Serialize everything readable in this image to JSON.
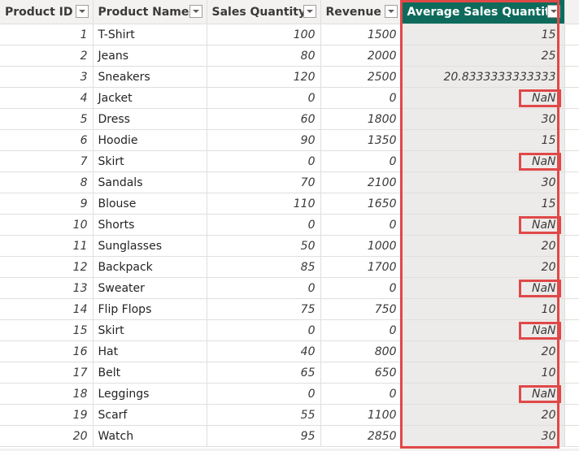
{
  "table": {
    "columns": [
      {
        "label": "Product ID"
      },
      {
        "label": "Product Name"
      },
      {
        "label": "Sales Quantity"
      },
      {
        "label": "Revenue"
      },
      {
        "label": "Average Sales Quantity",
        "selected": true
      }
    ],
    "rows": [
      {
        "id": "1",
        "name": "T-Shirt",
        "qty": "100",
        "revenue": "1500",
        "avg": "15"
      },
      {
        "id": "2",
        "name": "Jeans",
        "qty": "80",
        "revenue": "2000",
        "avg": "25"
      },
      {
        "id": "3",
        "name": "Sneakers",
        "qty": "120",
        "revenue": "2500",
        "avg": "20.8333333333333"
      },
      {
        "id": "4",
        "name": "Jacket",
        "qty": "0",
        "revenue": "0",
        "avg": "NaN",
        "highlight": true
      },
      {
        "id": "5",
        "name": "Dress",
        "qty": "60",
        "revenue": "1800",
        "avg": "30"
      },
      {
        "id": "6",
        "name": "Hoodie",
        "qty": "90",
        "revenue": "1350",
        "avg": "15"
      },
      {
        "id": "7",
        "name": "Skirt",
        "qty": "0",
        "revenue": "0",
        "avg": "NaN",
        "highlight": true
      },
      {
        "id": "8",
        "name": "Sandals",
        "qty": "70",
        "revenue": "2100",
        "avg": "30"
      },
      {
        "id": "9",
        "name": "Blouse",
        "qty": "110",
        "revenue": "1650",
        "avg": "15"
      },
      {
        "id": "10",
        "name": "Shorts",
        "qty": "0",
        "revenue": "0",
        "avg": "NaN",
        "highlight": true
      },
      {
        "id": "11",
        "name": "Sunglasses",
        "qty": "50",
        "revenue": "1000",
        "avg": "20"
      },
      {
        "id": "12",
        "name": "Backpack",
        "qty": "85",
        "revenue": "1700",
        "avg": "20"
      },
      {
        "id": "13",
        "name": "Sweater",
        "qty": "0",
        "revenue": "0",
        "avg": "NaN",
        "highlight": true
      },
      {
        "id": "14",
        "name": "Flip Flops",
        "qty": "75",
        "revenue": "750",
        "avg": "10"
      },
      {
        "id": "15",
        "name": "Skirt",
        "qty": "0",
        "revenue": "0",
        "avg": "NaN",
        "highlight": true
      },
      {
        "id": "16",
        "name": "Hat",
        "qty": "40",
        "revenue": "800",
        "avg": "20"
      },
      {
        "id": "17",
        "name": "Belt",
        "qty": "65",
        "revenue": "650",
        "avg": "10"
      },
      {
        "id": "18",
        "name": "Leggings",
        "qty": "0",
        "revenue": "0",
        "avg": "NaN",
        "highlight": true
      },
      {
        "id": "19",
        "name": "Scarf",
        "qty": "55",
        "revenue": "1100",
        "avg": "20"
      },
      {
        "id": "20",
        "name": "Watch",
        "qty": "95",
        "revenue": "2850",
        "avg": "30"
      }
    ]
  },
  "colors": {
    "selected_header_bg": "#0e6b5c",
    "highlight_border": "#e04848",
    "selected_column_bg": "#edebe9"
  }
}
